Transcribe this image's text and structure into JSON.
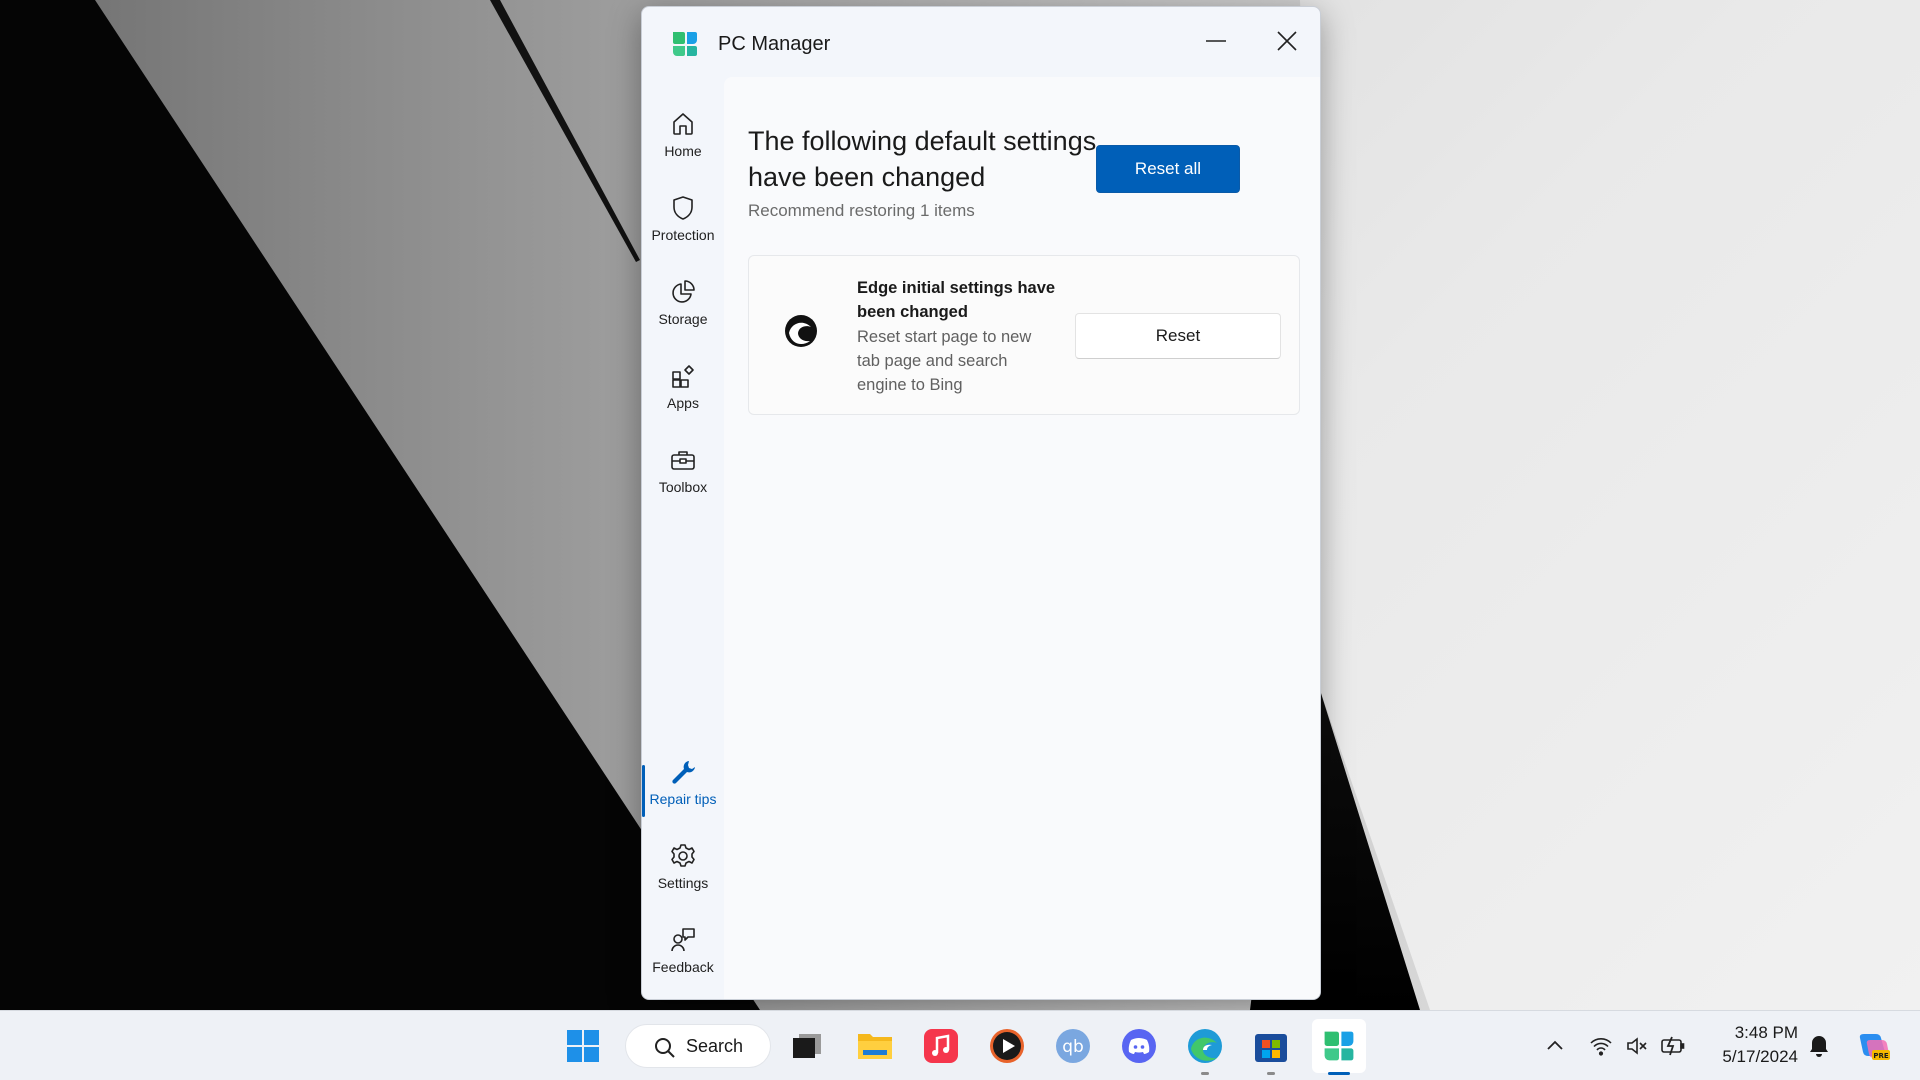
{
  "window": {
    "title": "PC Manager",
    "minimize_icon": "minimize-icon",
    "close_icon": "close-icon"
  },
  "sidebar": {
    "items": [
      {
        "label": "Home",
        "icon": "home-icon"
      },
      {
        "label": "Protection",
        "icon": "shield-icon"
      },
      {
        "label": "Storage",
        "icon": "pie-chart-icon"
      },
      {
        "label": "Apps",
        "icon": "apps-icon"
      },
      {
        "label": "Toolbox",
        "icon": "toolbox-icon"
      },
      {
        "label": "Repair tips",
        "icon": "wrench-icon",
        "active": true
      },
      {
        "label": "Settings",
        "icon": "gear-icon"
      },
      {
        "label": "Feedback",
        "icon": "feedback-icon"
      }
    ]
  },
  "main": {
    "heading": "The following default settings have been changed",
    "subheading": "Recommend restoring 1 items",
    "reset_all_label": "Reset all",
    "cards": [
      {
        "icon": "edge-icon",
        "title": "Edge initial settings have been changed",
        "description": "Reset start page to new tab page and search engine to Bing",
        "button_label": "Reset"
      }
    ]
  },
  "taskbar": {
    "search_label": "Search",
    "apps": [
      "start-icon",
      "task-view-icon",
      "file-explorer-icon",
      "music-icon",
      "media-player-icon",
      "qbittorrent-icon",
      "discord-icon",
      "edge-icon",
      "store-icon",
      "pc-manager-icon"
    ],
    "tray": {
      "time": "3:48 PM",
      "date": "5/17/2024"
    }
  },
  "colors": {
    "accent": "#005fb8",
    "window_bg": "#f3f6fb",
    "taskbar_bg": "#eef1f6"
  }
}
